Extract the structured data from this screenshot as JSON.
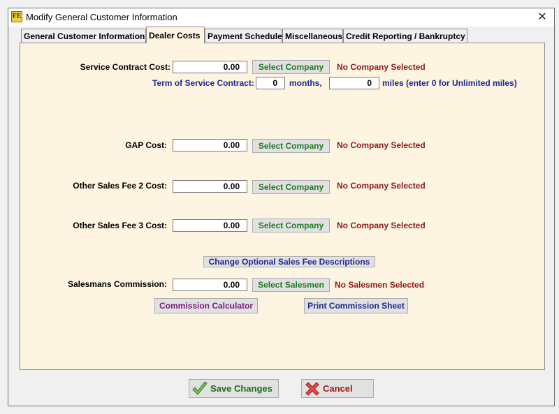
{
  "window": {
    "title": "Modify General Customer Information",
    "close_glyph": "✕",
    "app_icon_letters": "FE"
  },
  "tabs": [
    {
      "label": "General Customer Information",
      "active": false
    },
    {
      "label": "Dealer Costs",
      "active": true
    },
    {
      "label": "Payment Schedule",
      "active": false
    },
    {
      "label": "Miscellaneous",
      "active": false
    },
    {
      "label": "Credit Reporting / Bankruptcy",
      "active": false
    }
  ],
  "service_contract": {
    "label": "Service Contract Cost:",
    "value": "0.00",
    "select_label": "Select Company",
    "status": "No Company Selected",
    "term_label": "Term of Service Contract:",
    "months_value": "0",
    "months_label": "months,",
    "miles_value": "0",
    "miles_label": "miles (enter 0 for Unlimited miles)"
  },
  "gap": {
    "label": "GAP Cost:",
    "value": "0.00",
    "select_label": "Select Company",
    "status": "No Company Selected"
  },
  "fee2": {
    "label": "Other Sales Fee 2 Cost:",
    "value": "0.00",
    "select_label": "Select Company",
    "status": "No Company Selected"
  },
  "fee3": {
    "label": "Other Sales Fee 3 Cost:",
    "value": "0.00",
    "select_label": "Select Company",
    "status": "No Company Selected"
  },
  "change_descriptions_label": "Change Optional Sales Fee Descriptions",
  "commission": {
    "label": "Salesmans Commission:",
    "value": "0.00",
    "select_label": "Select Salesmen",
    "status": "No Salesmen Selected",
    "calculator_label": "Commission Calculator",
    "print_label": "Print Commission Sheet"
  },
  "footer": {
    "save_label": "Save Changes",
    "cancel_label": "Cancel"
  },
  "colors": {
    "panel_bg": "#fdf4e1",
    "label_blue": "#1a2a8c",
    "status_red": "#8b1a1a",
    "button_green": "#1f7a1f",
    "button_purple": "#7a1a7a"
  }
}
